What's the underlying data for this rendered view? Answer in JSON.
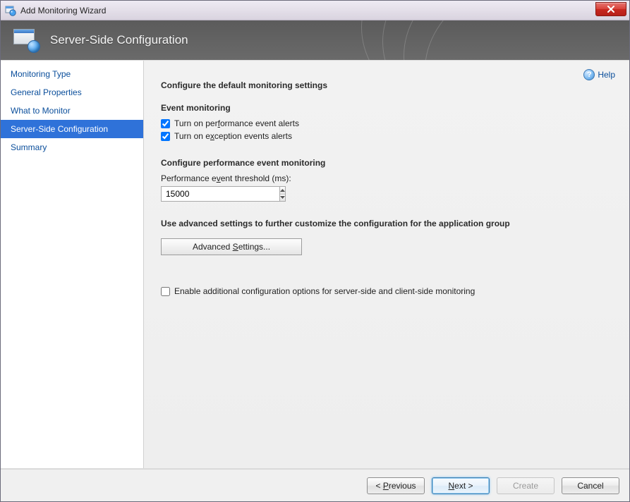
{
  "window": {
    "title": "Add Monitoring Wizard"
  },
  "banner": {
    "title": "Server-Side Configuration"
  },
  "sidebar": {
    "items": [
      {
        "label": "Monitoring Type",
        "selected": false
      },
      {
        "label": "General Properties",
        "selected": false
      },
      {
        "label": "What to Monitor",
        "selected": false
      },
      {
        "label": "Server-Side Configuration",
        "selected": true
      },
      {
        "label": "Summary",
        "selected": false
      }
    ]
  },
  "help": {
    "label": "Help"
  },
  "content": {
    "heading": "Configure the default monitoring settings",
    "event_monitoring_heading": "Event monitoring",
    "perf_alerts_label": "Turn on performance event alerts",
    "perf_alerts_checked": true,
    "exception_alerts_label": "Turn on exception events alerts",
    "exception_alerts_checked": true,
    "perf_config_heading": "Configure performance event monitoring",
    "threshold_label": "Performance event threshold (ms):",
    "threshold_value": "15000",
    "advanced_heading": "Use advanced settings to further customize the configuration for the application group",
    "advanced_button": "Advanced Settings...",
    "enable_additional_label": "Enable additional configuration options for server-side and client-side monitoring",
    "enable_additional_checked": false
  },
  "footer": {
    "previous": "< Previous",
    "next": "Next >",
    "create": "Create",
    "cancel": "Cancel"
  }
}
